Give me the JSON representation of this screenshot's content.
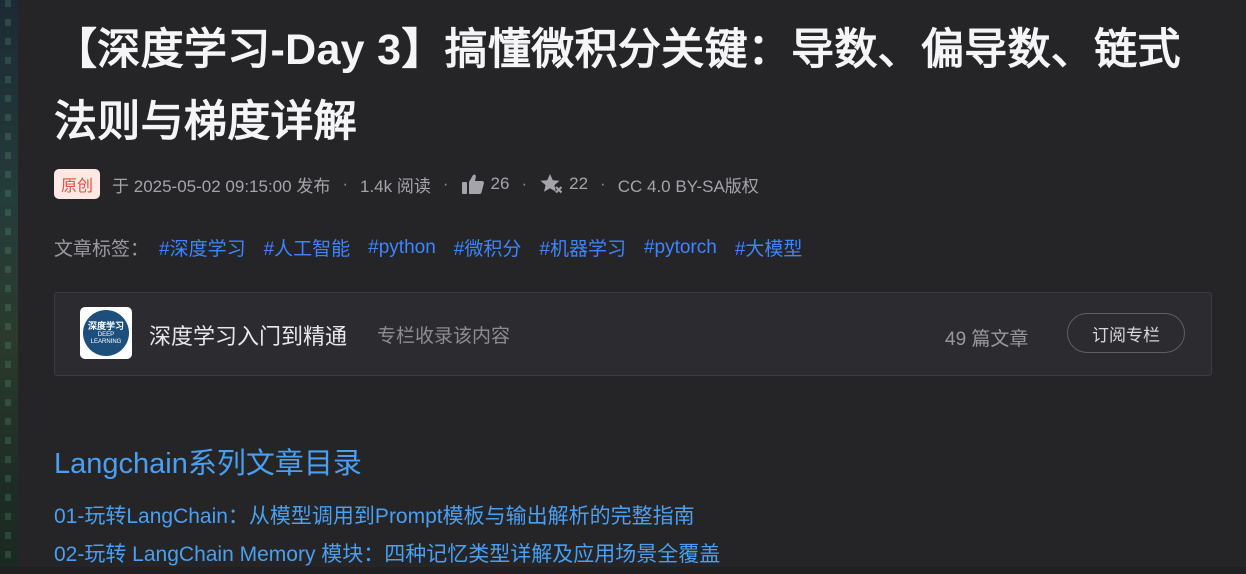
{
  "article": {
    "title": "【深度学习-Day 3】搞懂微积分关键：导数、偏导数、链式法则与梯度详解",
    "meta": {
      "badge": "原创",
      "published": "于 2025-05-02 09:15:00 发布",
      "reads": "1.4k 阅读",
      "likes": "26",
      "favorites": "22",
      "license": "CC 4.0 BY-SA版权"
    },
    "tags": {
      "label": "文章标签：",
      "items": [
        "#深度学习",
        "#人工智能",
        "#python",
        "#微积分",
        "#机器学习",
        "#pytorch",
        "#大模型"
      ]
    },
    "column": {
      "logo_text": "深度学习",
      "logo_sub": "DEEP LEARNING",
      "name": "深度学习入门到精通",
      "note": "专栏收录该内容",
      "count": "49 篇文章",
      "subscribe_label": "订阅专栏"
    },
    "toc": {
      "heading": "Langchain系列文章目录",
      "items": [
        "01-玩转LangChain：从模型调用到Prompt模板与输出解析的完整指南",
        "02-玩转 LangChain Memory 模块：四种记忆类型详解及应用场景全覆盖"
      ]
    }
  },
  "colors": {
    "background": "#252528",
    "accent_link": "#3d84ff",
    "toc_link": "#4a9ff0",
    "badge_text": "#e0523e",
    "badge_bg": "#fde8e4"
  },
  "icons": [
    "thumbs-up-icon",
    "star-icon"
  ]
}
